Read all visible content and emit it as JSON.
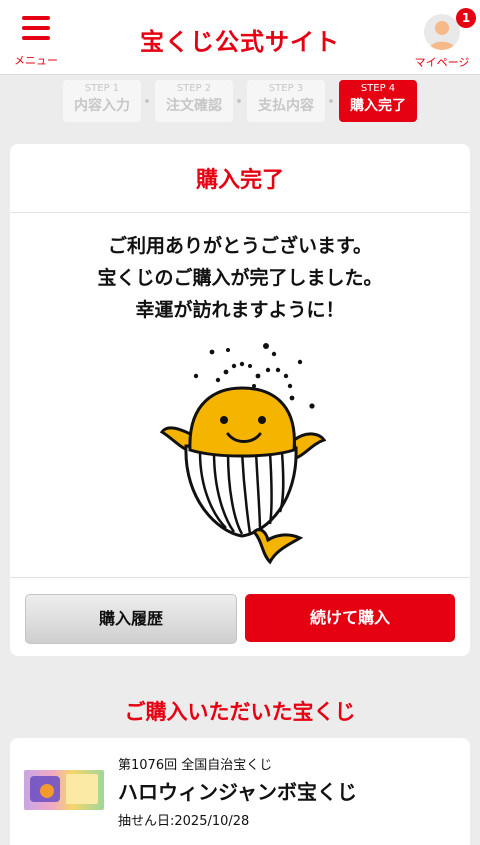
{
  "header": {
    "menu_label": "メニュー",
    "logo": "宝くじ公式サイト",
    "mypage_label": "マイページ",
    "badge_count": "1"
  },
  "steps": [
    {
      "num": "STEP 1",
      "name": "内容入力",
      "active": false
    },
    {
      "num": "STEP 2",
      "name": "注文確認",
      "active": false
    },
    {
      "num": "STEP 3",
      "name": "支払内容",
      "active": false
    },
    {
      "num": "STEP 4",
      "name": "購入完了",
      "active": true
    }
  ],
  "completion": {
    "title": "購入完了",
    "message_lines": [
      "ご利用ありがとうございます。",
      "宝くじのご購入が完了しました。",
      "幸運が訪れますように！"
    ],
    "history_button": "購入履歴",
    "continue_button": "続けて購入"
  },
  "purchased": {
    "section_title": "ご購入いただいた宝くじ",
    "round": "第1076回 全国自治宝くじ",
    "name": "ハロウィンジャンボ宝くじ",
    "draw_date": "抽せん日:2025/10/28"
  },
  "colors": {
    "accent": "#e50012",
    "background": "#ececec",
    "whale_yellow": "#f4b400"
  }
}
